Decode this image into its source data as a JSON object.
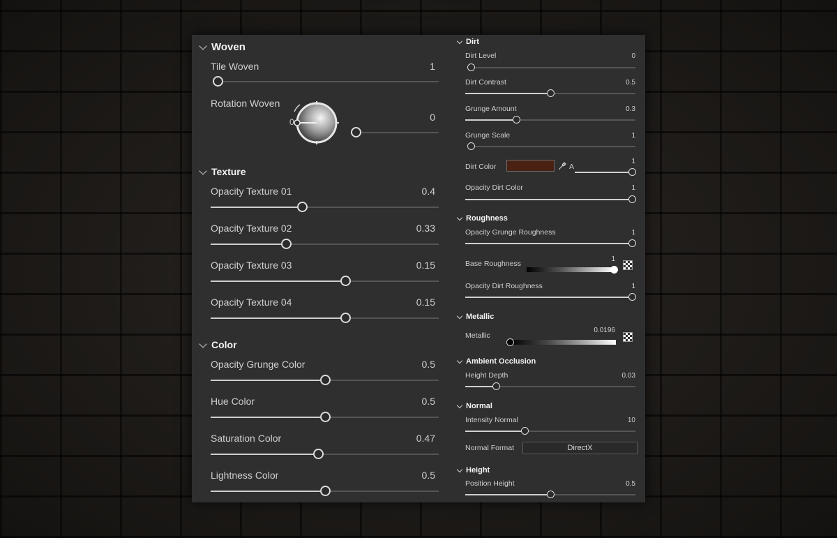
{
  "left": {
    "woven": {
      "title": "Woven",
      "tile": {
        "label": "Tile Woven",
        "value": "1",
        "fraction": 0
      },
      "rotation": {
        "label": "Rotation Woven",
        "value": "0",
        "dial_value": "0",
        "fraction": 0
      }
    },
    "texture": {
      "title": "Texture",
      "items": [
        {
          "label": "Opacity Texture 01",
          "value": "0.4",
          "fraction": 0.4
        },
        {
          "label": "Opacity Texture 02",
          "value": "0.33",
          "fraction": 0.33
        },
        {
          "label": "Opacity Texture 03",
          "value": "0.15",
          "fraction": 0.59
        },
        {
          "label": "Opacity Texture 04",
          "value": "0.15",
          "fraction": 0.59
        }
      ]
    },
    "color": {
      "title": "Color",
      "items": [
        {
          "label": "Opacity Grunge Color",
          "value": "0.5",
          "fraction": 0.5
        },
        {
          "label": "Hue Color",
          "value": "0.5",
          "fraction": 0.5
        },
        {
          "label": "Saturation Color",
          "value": "0.47",
          "fraction": 0.47
        },
        {
          "label": "Lightness Color",
          "value": "0.5",
          "fraction": 0.5
        }
      ]
    }
  },
  "right": {
    "dirt": {
      "title": "Dirt",
      "items": [
        {
          "label": "Dirt Level",
          "value": "0",
          "fraction": 0
        },
        {
          "label": "Dirt Contrast",
          "value": "0.5",
          "fraction": 0.5
        },
        {
          "label": "Grunge Amount",
          "value": "0.3",
          "fraction": 0.3
        },
        {
          "label": "Grunge Scale",
          "value": "1",
          "fraction": 0
        }
      ],
      "dirt_color": {
        "label": "Dirt Color",
        "swatch": "#4a2214",
        "alpha_label": "A",
        "alpha_value": "1",
        "alpha_fraction": 1
      },
      "opacity_dirt_color": {
        "label": "Opacity Dirt Color",
        "value": "1",
        "fraction": 1
      }
    },
    "roughness": {
      "title": "Roughness",
      "opacity_grunge": {
        "label": "Opacity Grunge Roughness",
        "value": "1",
        "fraction": 1
      },
      "base": {
        "label": "Base Roughness",
        "value": "1",
        "fraction": 1
      },
      "opacity_dirt": {
        "label": "Opacity Dirt Roughness",
        "value": "1",
        "fraction": 1
      }
    },
    "metallic": {
      "title": "Metallic",
      "item": {
        "label": "Metallic",
        "value": "0.0196",
        "fraction": 0.0196
      }
    },
    "ao": {
      "title": "Ambient Occlusion",
      "item": {
        "label": "Height Depth",
        "value": "0.03",
        "fraction": 0.18
      }
    },
    "normal": {
      "title": "Normal",
      "intensity": {
        "label": "Intensity Normal",
        "value": "10",
        "fraction": 0.35
      },
      "format": {
        "label": "Normal Format",
        "value": "DirectX"
      }
    },
    "height": {
      "title": "Height",
      "item": {
        "label": "Position Height",
        "value": "0.5",
        "fraction": 0.5
      }
    }
  },
  "colors": {
    "panel": "#2f2f2f",
    "accent": "#dcdcdc",
    "dirt_swatch": "#4a2214"
  }
}
